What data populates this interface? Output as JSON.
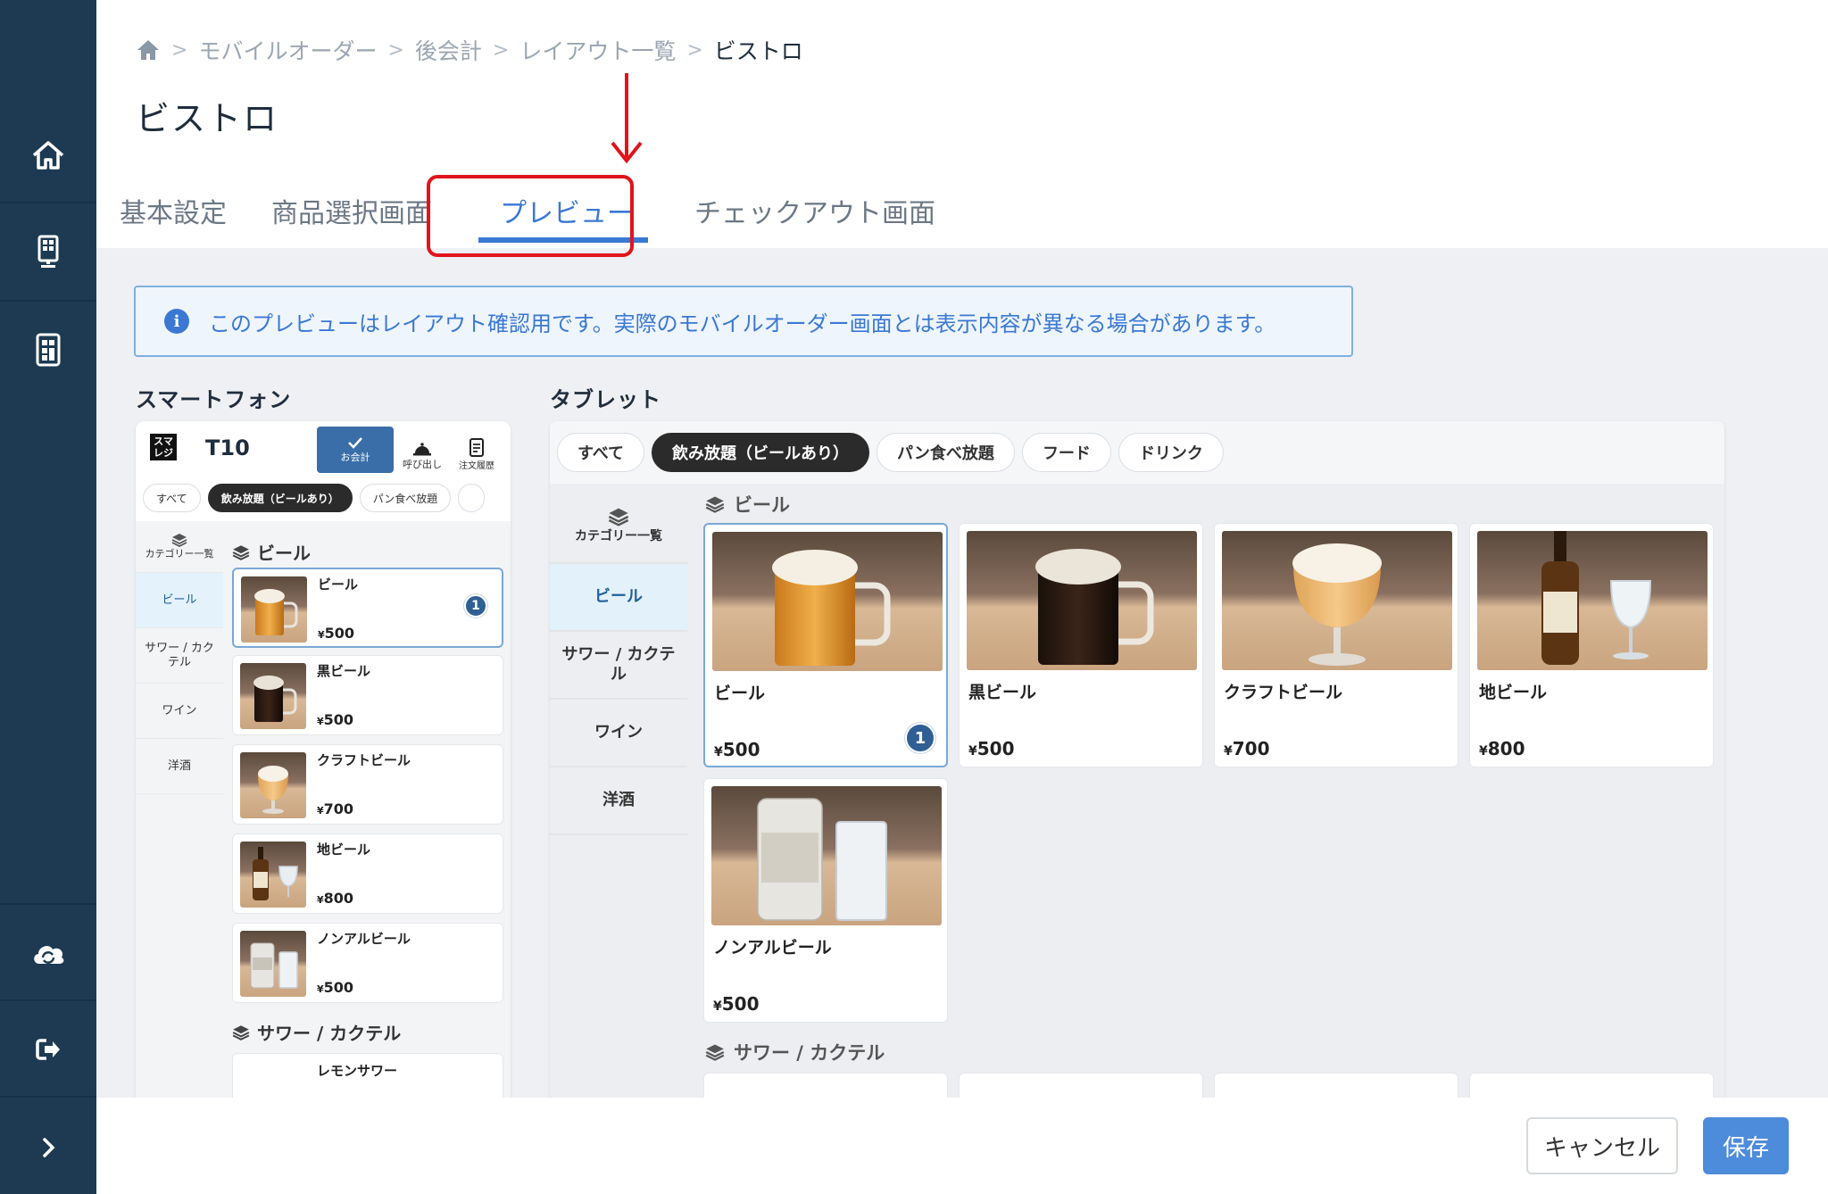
{
  "sidebar": {
    "items": [
      {
        "icon": "home-icon"
      },
      {
        "icon": "register-terminal-icon"
      },
      {
        "icon": "tablet-calculator-icon"
      },
      {
        "icon": "cloud-sync-icon"
      },
      {
        "icon": "logout-icon"
      },
      {
        "icon": "chevron-right-icon"
      }
    ]
  },
  "breadcrumb": {
    "items": [
      "モバイルオーダー",
      "後会計",
      "レイアウト一覧",
      "ビストロ"
    ]
  },
  "page_title": "ビストロ",
  "tabs": [
    {
      "label": "基本設定"
    },
    {
      "label": "商品選択画面"
    },
    {
      "label": "プレビュー",
      "active": true
    },
    {
      "label": "チェックアウト画面"
    }
  ],
  "info": {
    "icon": "i",
    "text": "このプレビューはレイアウト確認用です。実際のモバイルオーダー画面とは表示内容が異なる場合があります。"
  },
  "smartphone": {
    "section_label": "スマートフォン",
    "logo": "スマレジ",
    "logo_line1": "スマ",
    "logo_line2": "レジ",
    "table_no": "T10",
    "checkout_label": "お会計",
    "call_label": "呼び出し",
    "history_label": "注文履歴",
    "chips": [
      "すべて",
      "飲み放題（ビールあり）",
      "パン食べ放題"
    ],
    "categories_header": "カテゴリー一覧",
    "categories": [
      "ビール",
      "サワー / カクテル",
      "ワイン",
      "洋酒"
    ],
    "group1": "ビール",
    "items": [
      {
        "name": "ビール",
        "yen": "¥",
        "price": "500",
        "count": "1"
      },
      {
        "name": "黒ビール",
        "yen": "¥",
        "price": "500"
      },
      {
        "name": "クラフトビール",
        "yen": "¥",
        "price": "700"
      },
      {
        "name": "地ビール",
        "yen": "¥",
        "price": "800"
      },
      {
        "name": "ノンアルビール",
        "yen": "¥",
        "price": "500"
      }
    ],
    "group2": "サワー / カクテル",
    "next_item": "レモンサワー"
  },
  "tablet": {
    "section_label": "タブレット",
    "chips": [
      "すべて",
      "飲み放題（ビールあり）",
      "パン食べ放題",
      "フード",
      "ドリンク"
    ],
    "categories_header": "カテゴリー一覧",
    "categories": [
      "ビール",
      "サワー / カクテル",
      "ワイン",
      "洋酒"
    ],
    "group1": "ビール",
    "items": [
      {
        "name": "ビール",
        "yen": "¥",
        "price": "500",
        "count": "1"
      },
      {
        "name": "黒ビール",
        "yen": "¥",
        "price": "500"
      },
      {
        "name": "クラフトビール",
        "yen": "¥",
        "price": "700"
      },
      {
        "name": "地ビール",
        "yen": "¥",
        "price": "800"
      },
      {
        "name": "ノンアルビール",
        "yen": "¥",
        "price": "500"
      }
    ],
    "group2": "サワー / カクテル"
  },
  "footer": {
    "cancel_label": "キャンセル",
    "save_label": "保存"
  },
  "colors": {
    "sidebar": "#1d3a52",
    "accent": "#3a78d4",
    "annotation": "#e0141b",
    "save_button": "#4d8bdb"
  }
}
